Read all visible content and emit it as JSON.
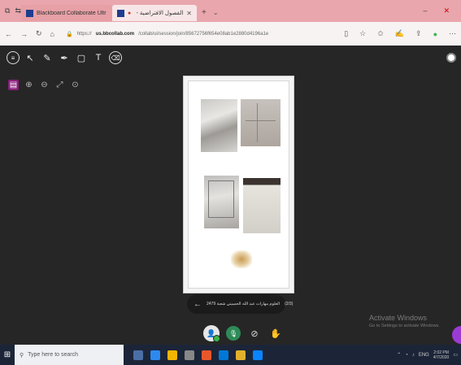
{
  "browser": {
    "tabs": [
      {
        "title": "Blackboard Collaborate Ultr",
        "active": false
      },
      {
        "title": "الفصول الافتراضية -",
        "active": true
      }
    ],
    "new_tab_label": "+",
    "url_prefix": "https://",
    "url_host": "us.bbcollab.com",
    "url_path": "/collab/ui/session/join/85672756f654e08ab1e2880d4196a1e",
    "nav_back": "←",
    "nav_forward": "→",
    "nav_reload": "↻",
    "nav_home": "⌂",
    "win_minimize": "–",
    "win_close": "✕"
  },
  "whiteboard": {
    "tools": [
      {
        "name": "menu-icon",
        "glyph": "≡"
      },
      {
        "name": "pointer-icon",
        "glyph": "↖"
      },
      {
        "name": "pen-icon",
        "glyph": "✎"
      },
      {
        "name": "marker-icon",
        "glyph": "✒"
      },
      {
        "name": "rectangle-icon",
        "glyph": "▢"
      },
      {
        "name": "text-icon",
        "glyph": "T"
      },
      {
        "name": "eraser-icon",
        "glyph": "⌫"
      }
    ],
    "zoom_tools": [
      {
        "name": "page-icon",
        "glyph": "▤",
        "active": true
      },
      {
        "name": "zoom-in-icon",
        "glyph": "⊕"
      },
      {
        "name": "zoom-out-icon",
        "glyph": "⊖"
      },
      {
        "name": "fit-screen-icon",
        "glyph": "⤢"
      },
      {
        "name": "zoom-reset-icon",
        "glyph": "⊙"
      }
    ],
    "page_indicator": "(2/3)",
    "file_name": "العلوم مهارات عبد الله الحسيني شعبة 2479",
    "prev_arrow": "←"
  },
  "controls": {
    "avatar_label": "👤",
    "mic": "🎙",
    "camera_off": "⊘",
    "hand": "✋"
  },
  "activation": {
    "title": "Activate Windows",
    "subtitle": "Go to Settings to activate Windows."
  },
  "taskbar": {
    "search_placeholder": "Type here to search",
    "time": "2:02 PM",
    "date": "4/7/2020",
    "icon_colors": [
      "#4a6fa5",
      "#2d89ef",
      "#f4b400",
      "#888",
      "#e8572a",
      "#0078d7",
      "#e1b12c",
      "#0a84ff"
    ]
  },
  "colors": {
    "tabbar": "#e9a6ac",
    "workspace": "#262626",
    "accent_purple": "#8a1f7a"
  }
}
